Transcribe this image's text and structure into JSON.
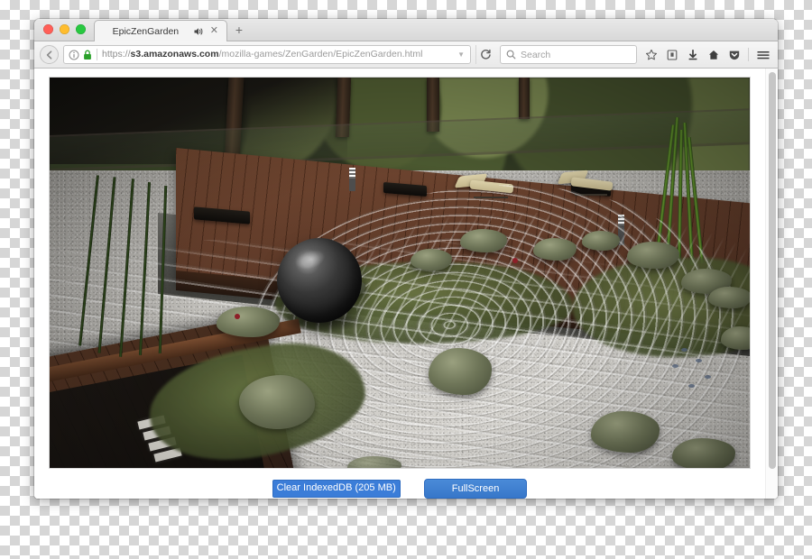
{
  "window": {
    "platform": "macOS",
    "traffic_lights": [
      {
        "name": "close",
        "color": "#ff5f57"
      },
      {
        "name": "minimize",
        "color": "#ffbd2e"
      },
      {
        "name": "zoom",
        "color": "#28c840"
      }
    ]
  },
  "tabs": [
    {
      "title": "EpicZenGarden",
      "audio_playing": true,
      "audio_icon": "speaker-icon",
      "close_icon": "close-icon",
      "active": true
    }
  ],
  "new_tab_label": "+",
  "toolbar": {
    "back_icon": "back-arrow-icon",
    "info_icon": "info-icon",
    "lock_icon": "padlock-icon",
    "reload_icon": "reload-icon",
    "dropdown_icon": "chevron-down-icon",
    "url": {
      "scheme": "https://",
      "domain": "s3.amazonaws.com",
      "path": "/mozilla-games/ZenGarden/EpicZenGarden.html",
      "full": "https://s3.amazonaws.com/mozilla-games/ZenGarden/EpicZenGarden.html",
      "secure": true
    },
    "search": {
      "placeholder": "Search",
      "value": "",
      "icon": "search-icon"
    },
    "icons": [
      {
        "name": "bookmark-star-icon",
        "glyph": "star"
      },
      {
        "name": "library-icon",
        "glyph": "library"
      },
      {
        "name": "downloads-icon",
        "glyph": "down-arrow"
      },
      {
        "name": "home-icon",
        "glyph": "house"
      },
      {
        "name": "pocket-icon",
        "glyph": "shield"
      },
      {
        "name": "menu-hamburger-icon",
        "glyph": "hamburger"
      }
    ]
  },
  "page": {
    "canvas": {
      "name": "webgl-zen-garden-canvas",
      "description": "3D rendered Japanese zen garden: raked gravel field, large dark polished stone sphere, wooden deck with two lounge chairs, moss patches, boulders, bamboo and surrounding foliage"
    },
    "buttons": {
      "clear_indexeddb": {
        "label": "Clear IndexedDB (205 MB)",
        "size_value": 205,
        "size_unit": "MB",
        "selected": true,
        "color": "#3b7dd8"
      },
      "fullscreen": {
        "label": "FullScreen",
        "color": "#3777c9"
      }
    },
    "scrollbar": {
      "name": "vertical-scrollbar",
      "position": "right"
    }
  },
  "colors": {
    "accent_blue": "#3b7dd8",
    "chrome_gray": "#e9e9e9",
    "tab_active": "#f4f4f4",
    "lock_green": "#2aa12a"
  }
}
